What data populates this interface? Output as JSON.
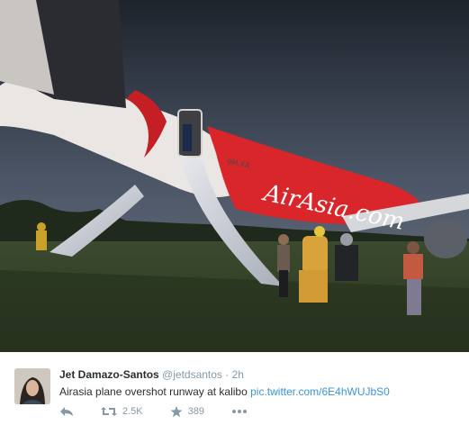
{
  "photo": {
    "fuselage_text": "AirAsia.com",
    "registration": "9M-XA"
  },
  "tweet": {
    "display_name": "Jet Damazo-Santos",
    "handle": "@jetdsantos",
    "separator": "·",
    "time": "2h",
    "text": "Airasia plane overshot runway at kalibo",
    "link": "pic.twitter.com/6E4hWUJbS0",
    "retweet_count": "2.5K",
    "favorite_count": "389"
  },
  "icons": {
    "reply": "reply-icon",
    "retweet": "retweet-icon",
    "favorite": "star-icon",
    "more": "more-icon"
  },
  "colors": {
    "link": "#3b94d9",
    "muted": "#8899a6",
    "airasia_red": "#d9262b"
  }
}
